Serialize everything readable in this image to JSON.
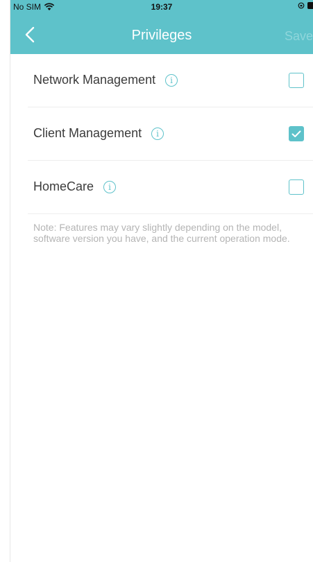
{
  "status_bar": {
    "carrier": "No SIM",
    "time": "19:37",
    "wifi_icon": "wifi-icon",
    "orientation_icon": "orientation-lock-icon",
    "battery_icon": "battery-icon"
  },
  "nav": {
    "title": "Privileges",
    "save_label": "Save",
    "back_icon": "chevron-left-icon"
  },
  "privileges": [
    {
      "label": "Network Management",
      "checked": false,
      "info_icon": "info-icon"
    },
    {
      "label": "Client Management",
      "checked": true,
      "info_icon": "info-icon"
    },
    {
      "label": "HomeCare",
      "checked": false,
      "info_icon": "info-icon"
    }
  ],
  "note": "Note: Features may vary slightly depending on the model, software version you have, and the current operation mode.",
  "colors": {
    "accent": "#5ec2ca",
    "save_disabled": "#8fd6db",
    "label_text": "#3b3b3b",
    "note_text": "#b4b4b4"
  }
}
